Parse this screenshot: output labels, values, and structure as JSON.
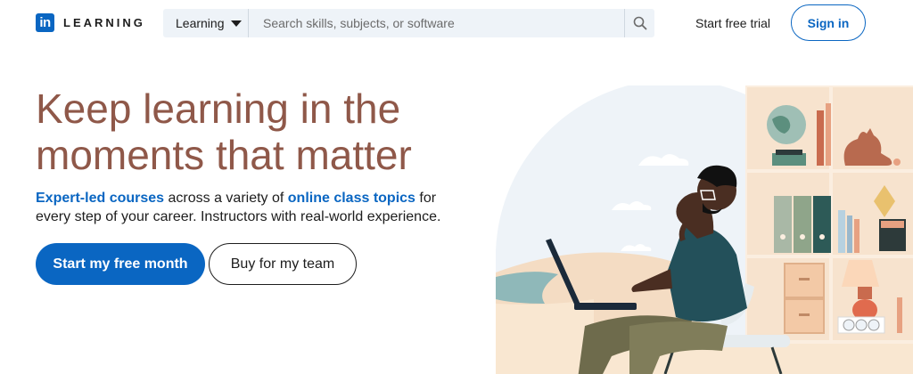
{
  "header": {
    "logo_badge": "in",
    "logo_text": "LEARNING",
    "search_scope": "Learning",
    "search_placeholder": "Search skills, subjects, or software",
    "trial_label": "Start free trial",
    "signin_label": "Sign in"
  },
  "hero": {
    "title": "Keep learning in the moments that matter",
    "sub_link1": "Expert-led courses",
    "sub_text1": " across a variety of ",
    "sub_link2": "online class topics",
    "sub_text2": " for every step of your career. Instructors with real-world experience.",
    "primary_cta": "Start my free month",
    "secondary_cta": "Buy for my team"
  },
  "colors": {
    "brand": "#0a66c2",
    "title": "#8f5849"
  }
}
